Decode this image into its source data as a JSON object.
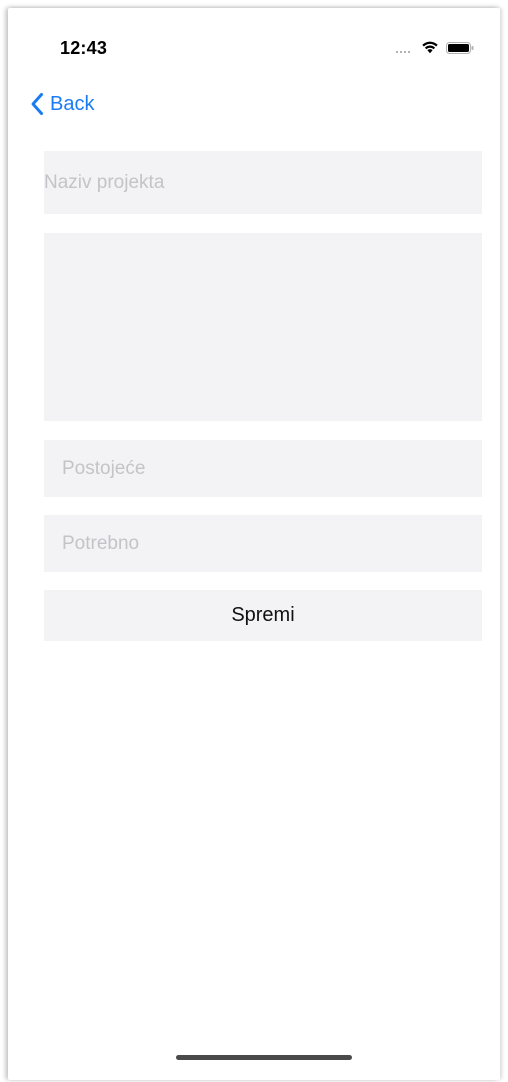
{
  "status_bar": {
    "time": "12:43"
  },
  "nav": {
    "back_label": "Back"
  },
  "form": {
    "project_name": {
      "placeholder": "Naziv projekta",
      "value": ""
    },
    "description": {
      "placeholder": "",
      "value": ""
    },
    "existing": {
      "placeholder": "Postojeće",
      "value": ""
    },
    "needed": {
      "placeholder": "Potrebno",
      "value": ""
    },
    "save_label": "Spremi"
  },
  "colors": {
    "accent": "#1a7cf5",
    "field_background": "#f3f3f6",
    "placeholder": "#c3c3c8"
  },
  "icons": {
    "back": "chevron-left-icon",
    "wifi": "wifi-icon",
    "battery": "battery-icon",
    "signal": "signal-dots-icon"
  }
}
